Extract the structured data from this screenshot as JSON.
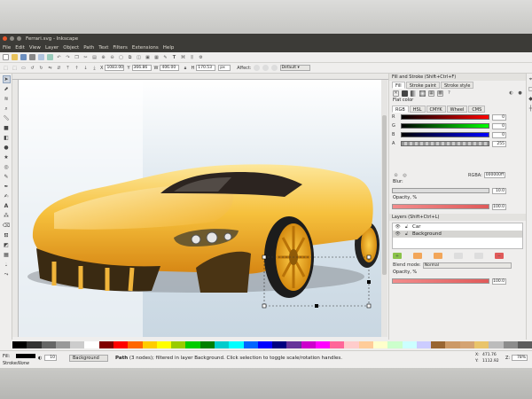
{
  "window": {
    "title": "Ferrari.svg - Inkscape"
  },
  "menu": [
    "File",
    "Edit",
    "View",
    "Layer",
    "Object",
    "Path",
    "Text",
    "Filters",
    "Extensions",
    "Help"
  ],
  "toolctl": {
    "x_label": "X",
    "x_value": "1083.00",
    "y_label": "Y",
    "y_value": "366.86",
    "w_label": "W",
    "w_value": "406.00",
    "h_label": "H",
    "h_value": "170.53",
    "unit": "px",
    "affect_label": "Affect:",
    "zoom_preset": "Default"
  },
  "fill_stroke": {
    "title": "Fill and Stroke (Shift+Ctrl+F)",
    "tabs": [
      "Fill",
      "Stroke paint",
      "Stroke style"
    ],
    "flat_color": "Flat color",
    "mode_tabs": [
      "RGB",
      "HSL",
      "CMYK",
      "Wheel",
      "CMS"
    ],
    "channels": [
      {
        "name": "R",
        "value": "0"
      },
      {
        "name": "G",
        "value": "0"
      },
      {
        "name": "B",
        "value": "0"
      },
      {
        "name": "A",
        "value": "255"
      }
    ],
    "rgba_label": "RGBA:",
    "rgba_value": "000000ff",
    "blur_label": "Blur:",
    "blur_value": "10.0",
    "opacity_label": "Opacity, %",
    "opacity_value": "100.0"
  },
  "layers": {
    "title": "Layers (Shift+Ctrl+L)",
    "items": [
      {
        "name": "Car"
      },
      {
        "name": "Background"
      }
    ],
    "blend_label": "Blend mode:",
    "blend_value": "Normal",
    "opacity_label": "Opacity, %",
    "opacity_value": "100.0"
  },
  "status": {
    "fill_label": "Fill:",
    "stroke_label": "Stroke:",
    "stroke_value": "None",
    "opacity_value": "10",
    "layer": "Background",
    "message_bold": "Path",
    "message": " (3 nodes); filtered in layer Background. Click selection to toggle scale/rotation handles.",
    "x_coord": "471.76",
    "y_coord": "1112.92",
    "zoom_label": "Z:",
    "zoom": "78%"
  },
  "colors": {
    "titlebar": "#3c3b37",
    "car_yellow": "#f3b52a",
    "selection": "#333333"
  }
}
